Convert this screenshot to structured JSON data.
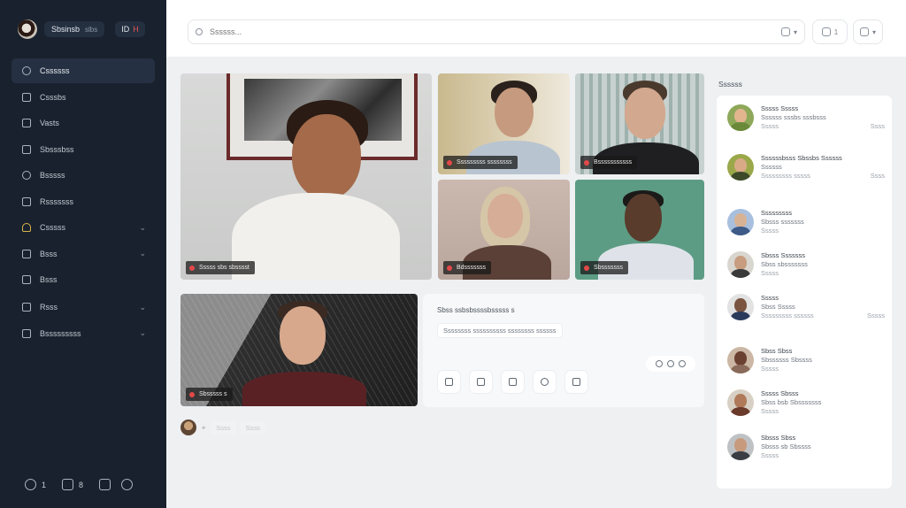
{
  "sidebar": {
    "brand": "Sbsinsb",
    "brand_sub": "slbs",
    "pill": [
      "ID",
      "H"
    ],
    "items": [
      {
        "label": "Cssssss",
        "chevron": false
      },
      {
        "label": "Csssbs",
        "chevron": false
      },
      {
        "label": "Vasts",
        "chevron": false
      },
      {
        "label": "Sbsssbss",
        "chevron": false
      },
      {
        "label": "Bsssss",
        "chevron": false
      },
      {
        "label": "Rsssssss",
        "chevron": false
      },
      {
        "label": "Csssss",
        "chevron": true
      },
      {
        "label": "Bsss",
        "chevron": true
      },
      {
        "label": "Bsss",
        "chevron": false
      },
      {
        "label": "Rsss",
        "chevron": true
      },
      {
        "label": "Bsssssssss",
        "chevron": true
      }
    ],
    "footer": [
      {
        "icon": "chat-icon",
        "count": "1"
      },
      {
        "icon": "grid-icon",
        "count": "8"
      },
      {
        "icon": "camera-icon",
        "count": ""
      },
      {
        "icon": "settings-icon",
        "count": ""
      }
    ]
  },
  "search": {
    "placeholder": "Ssssss...",
    "filter": "▾"
  },
  "topbar": {
    "btn1": "1",
    "btn2": "▾"
  },
  "videos": {
    "main": "Sssss sbs sbsssst",
    "t2": "Sssssssss ssssssss",
    "t3": "Bsssssssssss",
    "t4": "Bdsssssss",
    "t5": "Sbsssssss",
    "t6": "Sbsssss s"
  },
  "panel": {
    "title": "Sbss ssbsbssssbsssss s",
    "chip": "Ssssssss ssssssssss ssssssss ssssss",
    "controls": [
      "mute-icon",
      "mic-icon",
      "share-icon",
      "record-icon",
      "more-icon"
    ]
  },
  "under": {
    "chip1": "Ssss",
    "chip2": "Ssss"
  },
  "participants": {
    "title": "Ssssss",
    "list": [
      {
        "name": "Sssss Sssss",
        "sub": "Ssssss sssbs sssbsss",
        "meta": "Sssss",
        "meta_r": "Ssss"
      },
      {
        "name": "Ssssssbsss Sbssbs Ssssss",
        "sub": "Ssssss",
        "meta": "Sssssssss sssss",
        "meta_r": "Ssss"
      },
      {
        "name": "Sssssssss",
        "sub": "Sbsss sssssss",
        "meta": "Sssss",
        "meta_r": ""
      },
      {
        "name": "Sbsss Sssssss",
        "sub": "Sbss sbsssssss",
        "meta": "Sssss",
        "meta_r": ""
      },
      {
        "name": "Sssss",
        "sub": "Sbss Sssss",
        "meta": "Sssssssss ssssss",
        "meta_r": "Sssss"
      },
      {
        "name": "Sbss Sbss",
        "sub": "Sbssssss Sbssss",
        "meta": "Sssss",
        "meta_r": ""
      },
      {
        "name": "Sssss Sbsss",
        "sub": "Sbss bsb Sbsssssss",
        "meta": "Sssss",
        "meta_r": ""
      },
      {
        "name": "Sbsss Sbss",
        "sub": "Sbsss sb Sbssss",
        "meta": "Sssss",
        "meta_r": ""
      }
    ]
  },
  "colors": {
    "sidebar": "#18212d",
    "mic_off": "#e34848",
    "page_bg": "#eef0f2"
  }
}
